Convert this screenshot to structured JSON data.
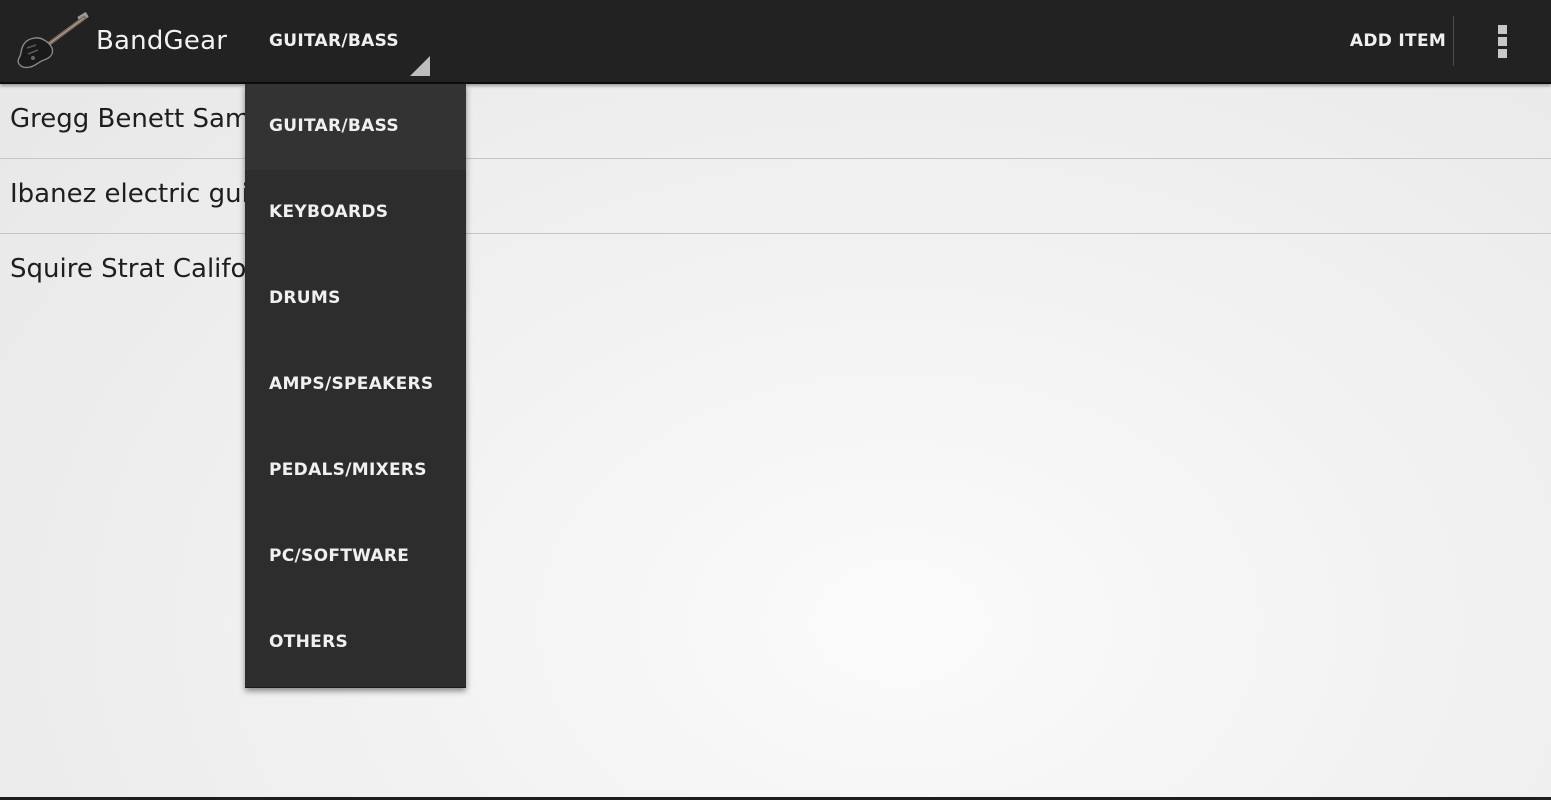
{
  "app": {
    "title": "BandGear",
    "icon": "guitar-icon"
  },
  "action_bar": {
    "spinner_selected": "GUITAR/BASS",
    "add_item_label": "ADD ITEM",
    "overflow_icon": "overflow-menu-icon"
  },
  "list": {
    "items": [
      {
        "label": "Gregg Benett Samick"
      },
      {
        "label": "Ibanez electric guitar"
      },
      {
        "label": "Squire Strat California"
      }
    ]
  },
  "dropdown": {
    "options": [
      {
        "label": "GUITAR/BASS",
        "selected": true
      },
      {
        "label": "KEYBOARDS",
        "selected": false
      },
      {
        "label": "DRUMS",
        "selected": false
      },
      {
        "label": "AMPS/SPEAKERS",
        "selected": false
      },
      {
        "label": "PEDALS/MIXERS",
        "selected": false
      },
      {
        "label": "PC/SOFTWARE",
        "selected": false
      },
      {
        "label": "OTHERS",
        "selected": false
      }
    ]
  },
  "colors": {
    "action_bar_bg": "#222222",
    "dropdown_bg": "#2d2d2d",
    "text_light": "#f0f0f0",
    "text_dark": "#1e1e1e"
  }
}
